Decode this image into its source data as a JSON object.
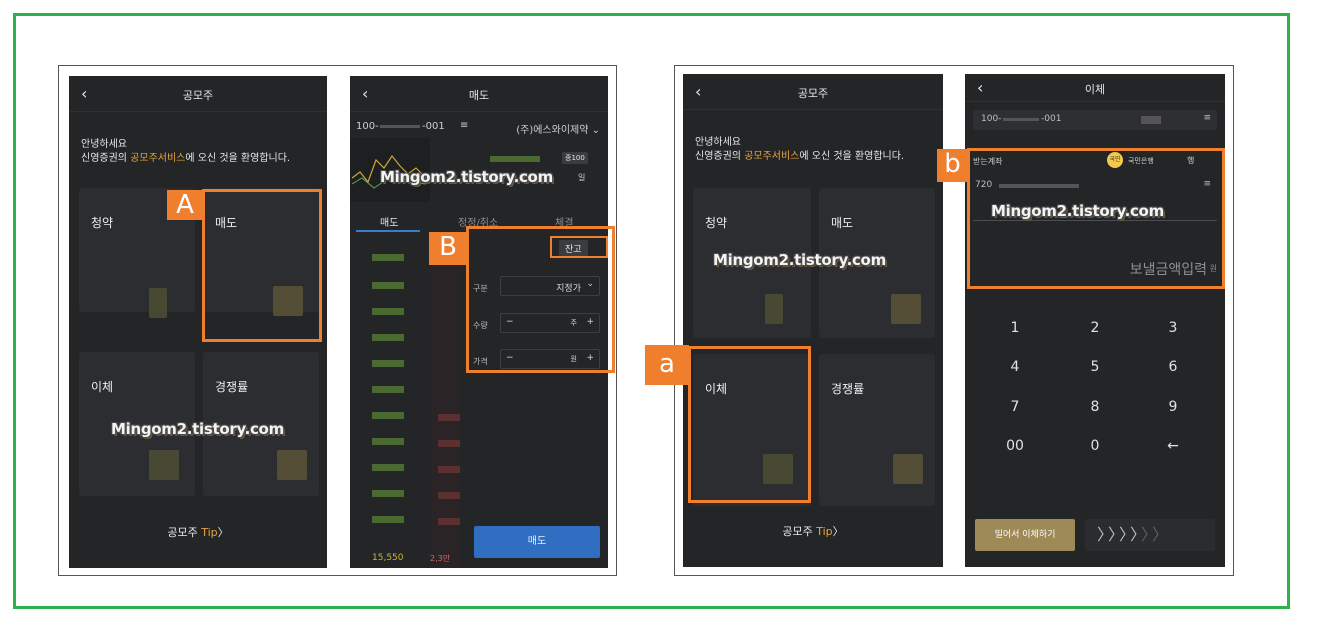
{
  "ipo_menu": {
    "title": "공모주",
    "greeting_line1": "안녕하세요",
    "greeting_line2_pre": "신영증권의 ",
    "greeting_line2_hl": "공모주서비스",
    "greeting_line2_post": "에 오신 것을 환영합니다.",
    "tiles": [
      "청약",
      "매도",
      "이체",
      "경쟁률"
    ],
    "tip_pre": "공모주 ",
    "tip_hl": "Tip",
    "tip_arrow": "〉"
  },
  "sell_screen": {
    "title": "매도",
    "account": "100-",
    "account_suffix": "-001",
    "stock_name": "(주)에스와이제약",
    "badge": "종100",
    "badge2": "일",
    "tabs": [
      "매도",
      "정정/취소",
      "체결"
    ],
    "balance_chip": "잔고",
    "type_label": "구분",
    "type_value": "지정가",
    "qty_label": "수량",
    "qty_minus": "−",
    "qty_unit": "주",
    "qty_plus": "+",
    "price_label": "가격",
    "price_minus": "−",
    "price_unit": "원",
    "price_plus": "+",
    "sell_button": "매도",
    "last_price": "15,550",
    "last_qty": "2,3만"
  },
  "transfer_screen": {
    "title": "이체",
    "account": "100-",
    "account_suffix": "-001",
    "receive_label": "받는계좌",
    "bank_logo": "국민",
    "bank_name": "국민은행",
    "bank_more": "행",
    "recv_account": "720",
    "amount_placeholder": "보낼금액입력",
    "amount_unit": "원",
    "keys": [
      "1",
      "2",
      "3",
      "4",
      "5",
      "6",
      "7",
      "8",
      "9",
      "00",
      "0",
      "←"
    ],
    "transfer_button": "밀어서 이체하기",
    "swipe_arrows": "〉〉〉〉",
    "swipe_arrows_dim": "〉〉"
  },
  "annotations": {
    "A": "A",
    "B": "B",
    "a": "a",
    "b": "b"
  },
  "watermark": "Mingom2.tistory.com",
  "colors": {
    "frame_border": "#2db34a",
    "highlight_box": "#ef7f2c",
    "accent_orange_text": "#e8a43c",
    "sell_button": "#2f6ec1",
    "screen_bg": "#232527"
  }
}
